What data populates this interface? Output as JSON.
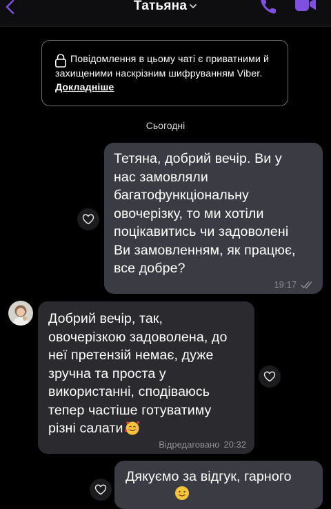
{
  "header": {
    "contact_name": "Татьяна",
    "back_icon": "chevron-left-icon",
    "call_icon": "phone-icon",
    "video_icon": "video-camera-icon",
    "accent_color": "#7f4fe0"
  },
  "encryption_notice": {
    "text": "Повідомлення в цьому чаті є приватними й захищеними наскрізним шифруванням Viber.",
    "link_label": "Докладніше",
    "icon": "lock-icon"
  },
  "date_separator": "Сьогодні",
  "messages": [
    {
      "direction": "outgoing",
      "text": "Тетяна, добрий вечір. Ви у\nнас замовляли\nбагатофункціональну\nовочерізку, то ми хотіли\nпоцікавитись чи задоволені\nВи замовленням, як працює,\nвсе добре?",
      "time": "19:17",
      "status_icon": "double-check-icon"
    },
    {
      "direction": "incoming",
      "text": "Добрий вечір, так,\nовочерізкою задоволена, до\nнеї претензій немає, дуже\nзручна та проста у\nвикористанні, сподіваюсь\nтепер частіше готуватиму\nрізні салати",
      "emoji": "smiling-face-with-hearts",
      "edited_label": "Відредаговано",
      "time": "20:32"
    },
    {
      "direction": "outgoing",
      "text": "Дякуємо за відгук, гарного",
      "emoji": "slightly-smiling-face"
    }
  ]
}
